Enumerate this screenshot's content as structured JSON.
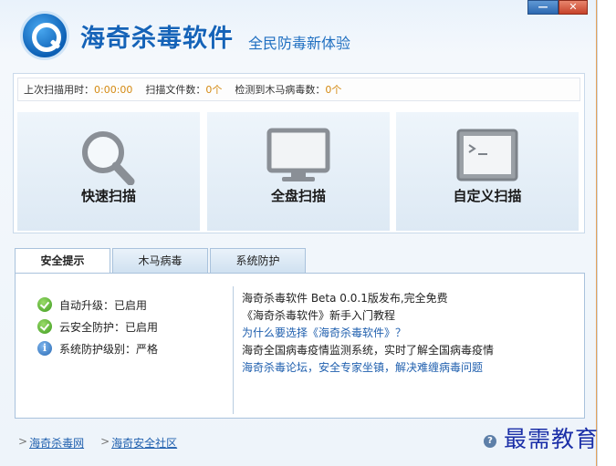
{
  "app": {
    "title": "海奇杀毒软件",
    "slogan": "全民防毒新体验"
  },
  "window_controls": {
    "minimize": "—",
    "close": "✕"
  },
  "stats": {
    "last_scan_label": "上次扫描用时：",
    "last_scan_value": "0:00:00",
    "files_label": "扫描文件数：",
    "files_value": "0个",
    "trojans_label": "检测到木马病毒数：",
    "trojans_value": "0个"
  },
  "scan_buttons": {
    "quick": "快速扫描",
    "full": "全盘扫描",
    "custom": "自定义扫描"
  },
  "tabs": [
    "安全提示",
    "木马病毒",
    "系统防护"
  ],
  "status": [
    {
      "text": "自动升级：已启用",
      "icon": "check-icon"
    },
    {
      "text": "云安全防护：已启用",
      "icon": "check-icon"
    },
    {
      "text": "系统防护级别：严格",
      "icon": "info-icon"
    }
  ],
  "news": [
    "海奇杀毒软件 Beta 0.0.1版发布,完全免费",
    "《海奇杀毒软件》新手入门教程",
    "为什么要选择《海奇杀毒软件》？",
    "海奇全国病毒疫情监测系统，实时了解全国病毒疫情",
    "海奇杀毒论坛，安全专家坐镇，解决难缠病毒问题"
  ],
  "footer": {
    "link1": "海奇杀毒网",
    "link2": "海奇安全社区",
    "help": "?"
  },
  "watermark": "最需教育",
  "colors": {
    "accent": "#1563b8",
    "value": "#d48a12",
    "link": "#1f5fae"
  }
}
